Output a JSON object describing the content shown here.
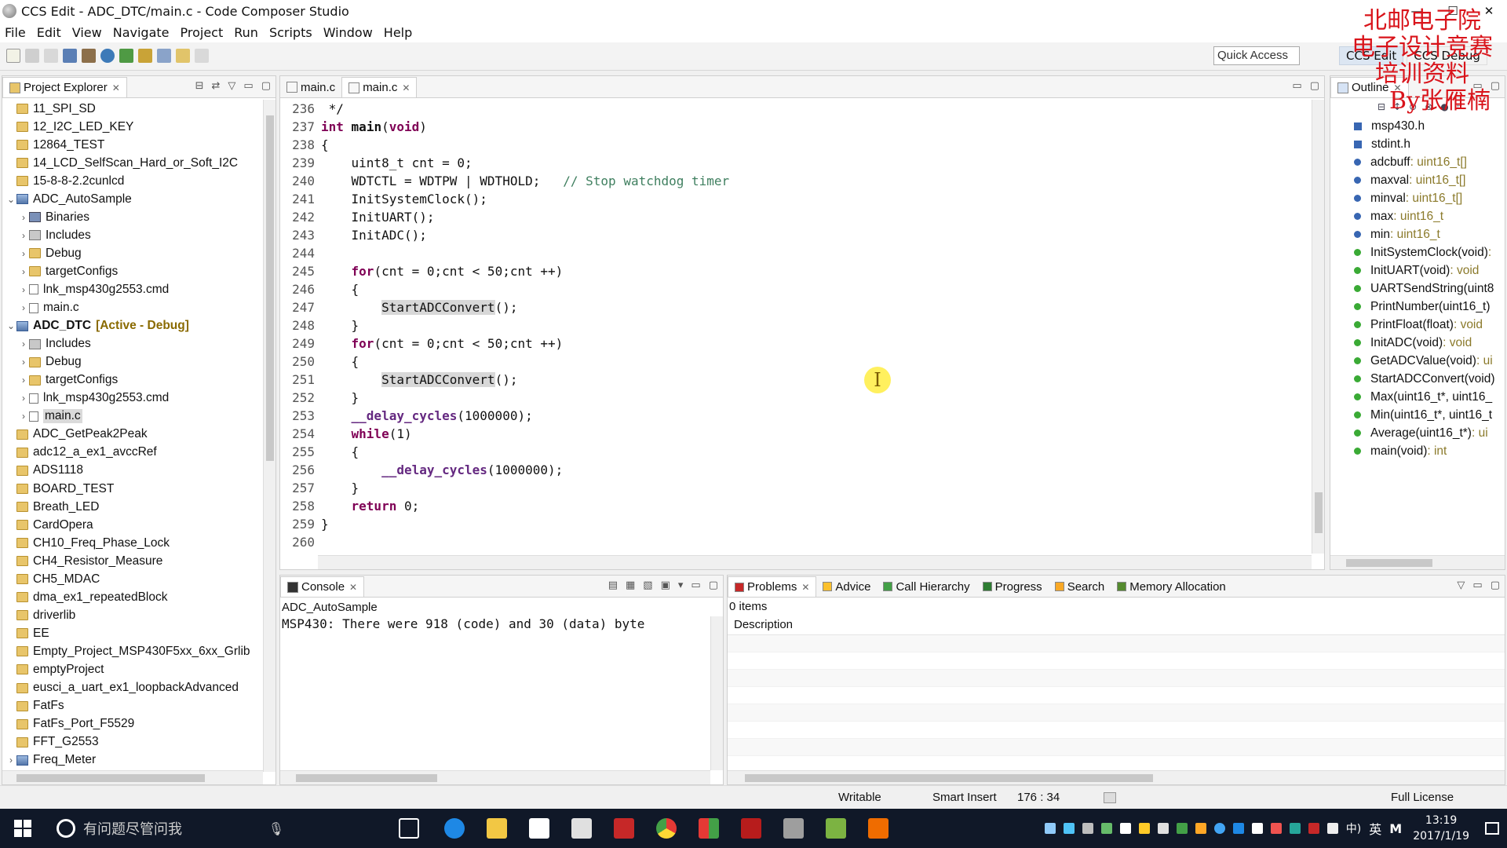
{
  "window": {
    "title": "CCS Edit - ADC_DTC/main.c - Code Composer Studio",
    "controls": {
      "minimize": "—",
      "maximize": "☐",
      "close": "✕"
    }
  },
  "menu": [
    "File",
    "Edit",
    "View",
    "Navigate",
    "Project",
    "Run",
    "Scripts",
    "Window",
    "Help"
  ],
  "toolbar": {
    "quick_access": "Quick Access",
    "perspectives": [
      "CCS Edit",
      "CCS Debug"
    ]
  },
  "watermark": {
    "line1": "北邮电子院",
    "line2": "电子设计竞赛",
    "line3": "培训资料",
    "line4": "By张雁楠"
  },
  "project_explorer": {
    "tab_label": "Project Explorer",
    "items": [
      {
        "label": "11_SPI_SD",
        "level": 0,
        "icon": "folder",
        "arrow": ""
      },
      {
        "label": "12_I2C_LED_KEY",
        "level": 0,
        "icon": "folder",
        "arrow": ""
      },
      {
        "label": "12864_TEST",
        "level": 0,
        "icon": "folder",
        "arrow": ""
      },
      {
        "label": "14_LCD_SelfScan_Hard_or_Soft_I2C",
        "level": 0,
        "icon": "folder",
        "arrow": ""
      },
      {
        "label": "15-8-8-2.2cunlcd",
        "level": 0,
        "icon": "folder",
        "arrow": ""
      },
      {
        "label": "ADC_AutoSample",
        "level": 0,
        "icon": "project",
        "arrow": "⌄"
      },
      {
        "label": "Binaries",
        "level": 1,
        "icon": "bin",
        "arrow": "›"
      },
      {
        "label": "Includes",
        "level": 1,
        "icon": "inc",
        "arrow": "›"
      },
      {
        "label": "Debug",
        "level": 1,
        "icon": "folder",
        "arrow": "›"
      },
      {
        "label": "targetConfigs",
        "level": 1,
        "icon": "folder",
        "arrow": "›"
      },
      {
        "label": "lnk_msp430g2553.cmd",
        "level": 1,
        "icon": "file",
        "arrow": "›"
      },
      {
        "label": "main.c",
        "level": 1,
        "icon": "file",
        "arrow": "›"
      },
      {
        "label": "ADC_DTC",
        "level": 0,
        "icon": "project",
        "arrow": "⌄",
        "bold": true,
        "suffix": "[Active - Debug]"
      },
      {
        "label": "Includes",
        "level": 1,
        "icon": "inc",
        "arrow": "›"
      },
      {
        "label": "Debug",
        "level": 1,
        "icon": "folder",
        "arrow": "›"
      },
      {
        "label": "targetConfigs",
        "level": 1,
        "icon": "folder",
        "arrow": "›"
      },
      {
        "label": "lnk_msp430g2553.cmd",
        "level": 1,
        "icon": "file",
        "arrow": "›"
      },
      {
        "label": "main.c",
        "level": 1,
        "icon": "file",
        "arrow": "›",
        "selected": true
      },
      {
        "label": "ADC_GetPeak2Peak",
        "level": 0,
        "icon": "folder",
        "arrow": ""
      },
      {
        "label": "adc12_a_ex1_avccRef",
        "level": 0,
        "icon": "folder",
        "arrow": ""
      },
      {
        "label": "ADS1118",
        "level": 0,
        "icon": "folder",
        "arrow": ""
      },
      {
        "label": "BOARD_TEST",
        "level": 0,
        "icon": "folder",
        "arrow": ""
      },
      {
        "label": "Breath_LED",
        "level": 0,
        "icon": "folder",
        "arrow": ""
      },
      {
        "label": "CardOpera",
        "level": 0,
        "icon": "folder",
        "arrow": ""
      },
      {
        "label": "CH10_Freq_Phase_Lock",
        "level": 0,
        "icon": "folder",
        "arrow": ""
      },
      {
        "label": "CH4_Resistor_Measure",
        "level": 0,
        "icon": "folder",
        "arrow": ""
      },
      {
        "label": "CH5_MDAC",
        "level": 0,
        "icon": "folder",
        "arrow": ""
      },
      {
        "label": "dma_ex1_repeatedBlock",
        "level": 0,
        "icon": "folder",
        "arrow": ""
      },
      {
        "label": "driverlib",
        "level": 0,
        "icon": "folder",
        "arrow": ""
      },
      {
        "label": "EE",
        "level": 0,
        "icon": "folder",
        "arrow": ""
      },
      {
        "label": "Empty_Project_MSP430F5xx_6xx_Grlib",
        "level": 0,
        "icon": "folder",
        "arrow": ""
      },
      {
        "label": "emptyProject",
        "level": 0,
        "icon": "folder",
        "arrow": ""
      },
      {
        "label": "eusci_a_uart_ex1_loopbackAdvanced",
        "level": 0,
        "icon": "folder",
        "arrow": ""
      },
      {
        "label": "FatFs",
        "level": 0,
        "icon": "folder",
        "arrow": ""
      },
      {
        "label": "FatFs_Port_F5529",
        "level": 0,
        "icon": "folder",
        "arrow": ""
      },
      {
        "label": "FFT_G2553",
        "level": 0,
        "icon": "folder",
        "arrow": ""
      },
      {
        "label": "Freq_Meter",
        "level": 0,
        "icon": "project",
        "arrow": "›"
      }
    ]
  },
  "editor": {
    "tabs": [
      {
        "label": "main.c",
        "active": false
      },
      {
        "label": "main.c",
        "active": true
      }
    ],
    "lines": [
      {
        "n": "236",
        "html": " */",
        "cls": "plain"
      },
      {
        "n": "237",
        "tokens": [
          [
            "kw",
            "int"
          ],
          [
            "",
            " "
          ],
          [
            "fn",
            "main"
          ],
          [
            "",
            "("
          ],
          [
            "kw",
            "void"
          ],
          [
            "",
            ")"
          ]
        ]
      },
      {
        "n": "238",
        "tokens": [
          [
            "",
            "{"
          ]
        ]
      },
      {
        "n": "239",
        "tokens": [
          [
            "",
            "    uint8_t cnt = 0;"
          ]
        ]
      },
      {
        "n": "240",
        "tokens": [
          [
            "",
            "    WDTCTL = WDTPW | WDTHOLD;   "
          ],
          [
            "cm",
            "// Stop watchdog timer"
          ]
        ]
      },
      {
        "n": "241",
        "tokens": [
          [
            "",
            "    InitSystemClock();"
          ]
        ]
      },
      {
        "n": "242",
        "tokens": [
          [
            "",
            "    InitUART();"
          ]
        ]
      },
      {
        "n": "243",
        "tokens": [
          [
            "",
            "    InitADC();"
          ]
        ]
      },
      {
        "n": "244",
        "tokens": [
          [
            "",
            ""
          ]
        ]
      },
      {
        "n": "245",
        "tokens": [
          [
            "",
            "    "
          ],
          [
            "kw",
            "for"
          ],
          [
            "",
            "(cnt = 0;cnt < 50;cnt ++)"
          ]
        ]
      },
      {
        "n": "246",
        "tokens": [
          [
            "",
            "    {"
          ]
        ]
      },
      {
        "n": "247",
        "tokens": [
          [
            "",
            "        "
          ],
          [
            "hl",
            "StartADCConvert"
          ],
          [
            "",
            "();"
          ]
        ]
      },
      {
        "n": "248",
        "tokens": [
          [
            "",
            "    }"
          ]
        ]
      },
      {
        "n": "249",
        "tokens": [
          [
            "",
            "    "
          ],
          [
            "kw",
            "for"
          ],
          [
            "",
            "(cnt = 0;cnt < 50;cnt ++)"
          ]
        ]
      },
      {
        "n": "250",
        "tokens": [
          [
            "",
            "    {"
          ]
        ]
      },
      {
        "n": "251",
        "tokens": [
          [
            "",
            "        "
          ],
          [
            "hl",
            "StartADCConvert"
          ],
          [
            "",
            "();"
          ]
        ]
      },
      {
        "n": "252",
        "tokens": [
          [
            "",
            "    }"
          ]
        ]
      },
      {
        "n": "253",
        "tokens": [
          [
            "",
            "    "
          ],
          [
            "dl",
            "__delay_cycles"
          ],
          [
            "",
            "(1000000);"
          ]
        ]
      },
      {
        "n": "254",
        "tokens": [
          [
            "",
            "    "
          ],
          [
            "kw",
            "while"
          ],
          [
            "",
            "(1)"
          ]
        ]
      },
      {
        "n": "255",
        "tokens": [
          [
            "",
            "    {"
          ]
        ]
      },
      {
        "n": "256",
        "tokens": [
          [
            "",
            "        "
          ],
          [
            "dl",
            "__delay_cycles"
          ],
          [
            "",
            "(1000000);"
          ]
        ]
      },
      {
        "n": "257",
        "tokens": [
          [
            "",
            "    }"
          ]
        ]
      },
      {
        "n": "258",
        "tokens": [
          [
            "",
            "    "
          ],
          [
            "kw",
            "return"
          ],
          [
            "",
            " 0;"
          ]
        ]
      },
      {
        "n": "259",
        "tokens": [
          [
            "",
            "}"
          ]
        ]
      },
      {
        "n": "260",
        "tokens": [
          [
            "",
            ""
          ]
        ]
      }
    ],
    "cursor_glyph": "I"
  },
  "outline": {
    "tab_label": "Outline",
    "items": [
      {
        "name": "msp430.h",
        "type": "",
        "kind": "include"
      },
      {
        "name": "stdint.h",
        "type": "",
        "kind": "include"
      },
      {
        "name": "adcbuff",
        "type": " : uint16_t[]",
        "kind": "var"
      },
      {
        "name": "maxval",
        "type": " : uint16_t[]",
        "kind": "var"
      },
      {
        "name": "minval",
        "type": " : uint16_t[]",
        "kind": "var"
      },
      {
        "name": "max",
        "type": " : uint16_t",
        "kind": "var"
      },
      {
        "name": "min",
        "type": " : uint16_t",
        "kind": "var"
      },
      {
        "name": "InitSystemClock(void)",
        "type": " :",
        "kind": "func"
      },
      {
        "name": "InitUART(void)",
        "type": " : void",
        "kind": "func"
      },
      {
        "name": "UARTSendString(uint8",
        "type": "",
        "kind": "func"
      },
      {
        "name": "PrintNumber(uint16_t)",
        "type": "",
        "kind": "func"
      },
      {
        "name": "PrintFloat(float)",
        "type": " : void",
        "kind": "func"
      },
      {
        "name": "InitADC(void)",
        "type": " : void",
        "kind": "func"
      },
      {
        "name": "GetADCValue(void)",
        "type": " : ui",
        "kind": "func"
      },
      {
        "name": "StartADCConvert(void)",
        "type": "",
        "kind": "func"
      },
      {
        "name": "Max(uint16_t*, uint16_",
        "type": "",
        "kind": "func"
      },
      {
        "name": "Min(uint16_t*, uint16_t",
        "type": "",
        "kind": "func"
      },
      {
        "name": "Average(uint16_t*)",
        "type": " : ui",
        "kind": "func"
      },
      {
        "name": "main(void)",
        "type": " : int",
        "kind": "func"
      }
    ]
  },
  "console": {
    "tab_label": "Console",
    "project": "ADC_AutoSample",
    "output": "MSP430:  There were 918 (code) and 30 (data) byte"
  },
  "problems": {
    "tabs": [
      "Problems",
      "Advice",
      "Call Hierarchy",
      "Progress",
      "Search",
      "Memory Allocation"
    ],
    "count": "0 items",
    "column": "Description"
  },
  "status": {
    "writable": "Writable",
    "insert_mode": "Smart Insert",
    "position": "176 : 34",
    "license": "Full License"
  },
  "taskbar": {
    "search_placeholder": "有问题尽管问我",
    "time": "13:19",
    "date": "2017/1/19",
    "ime": "英",
    "ime2": "M",
    "volume": "中)"
  },
  "colors": {
    "keyword": "#7f0055",
    "comment": "#3f7f5f",
    "outline_var": "#3866b2",
    "outline_func": "#3aaa35",
    "watermark": "#d9141b"
  }
}
